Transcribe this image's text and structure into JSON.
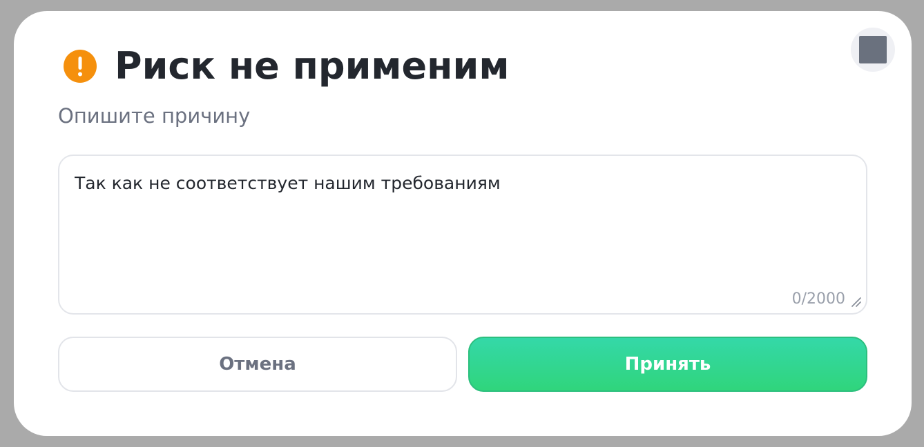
{
  "dialog": {
    "title": "Риск не применим",
    "subtitle": "Опишите причину",
    "reason_field": {
      "value": "Так как не соответствует нашим требованиям",
      "counter": "0/2000"
    },
    "buttons": {
      "cancel_label": "Отмена",
      "accept_label": "Принять"
    },
    "icons": {
      "status": "warning-icon",
      "close": "close-icon",
      "resize": "resize-handle-icon"
    }
  },
  "colors": {
    "overlay": "#aaaaaa",
    "warning": "#f5900d",
    "accent_green": "#32d68a",
    "title_text": "#23272e",
    "muted_text": "#6b7180",
    "close_button_bg": "#eff0f4",
    "close_glyph": "#6a717e"
  }
}
